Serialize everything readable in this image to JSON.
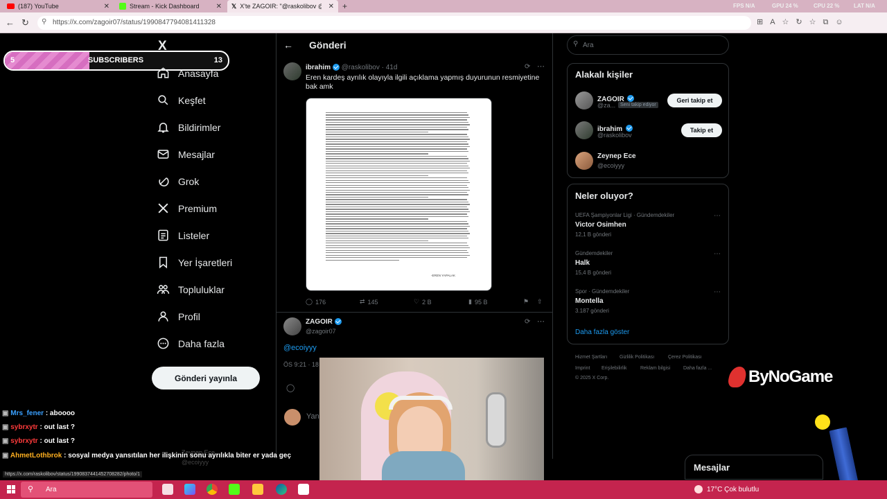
{
  "browser": {
    "tabs": [
      {
        "label": "(187) YouTube",
        "icon": "youtube-icon"
      },
      {
        "label": "Stream - Kick Dashboard",
        "icon": "kick-icon"
      },
      {
        "label": "X'te ZAGOIR: \"@raskolibov @eco",
        "icon": "x-icon"
      }
    ],
    "url": "https://x.com/zagoir07/status/1990847794081411328",
    "stats": {
      "fps": "FPS N/A",
      "gpu": "GPU 24 %",
      "cpu": "CPU 22 %",
      "lat": "LAT N/A"
    }
  },
  "subscribers": {
    "current": "5",
    "label": "SUBSCRIBERS",
    "goal": "13",
    "progress": 0.38
  },
  "nav": {
    "logo": "X",
    "items": [
      {
        "label": "Anasayfa",
        "icon": "home-icon"
      },
      {
        "label": "Keşfet",
        "icon": "search-icon"
      },
      {
        "label": "Bildirimler",
        "icon": "bell-icon"
      },
      {
        "label": "Mesajlar",
        "icon": "mail-icon"
      },
      {
        "label": "Grok",
        "icon": "grok-icon"
      },
      {
        "label": "Premium",
        "icon": "x-icon"
      },
      {
        "label": "Listeler",
        "icon": "list-icon"
      },
      {
        "label": "Yer İşaretleri",
        "icon": "bookmark-icon"
      },
      {
        "label": "Topluluklar",
        "icon": "communities-icon"
      },
      {
        "label": "Profil",
        "icon": "profile-icon"
      },
      {
        "label": "Daha fazla",
        "icon": "more-icon"
      }
    ],
    "post_button": "Gönderi yayınla"
  },
  "main": {
    "header": "Gönderi",
    "tweet1": {
      "name": "ibrahim",
      "handle": "@raskolibov",
      "time": "· 41d",
      "text": "Eren kardeş ayrılık olayıyla ilgili açıklama yapmış duyurunun resmiyetine bak amk",
      "image_signature": "-EREN YAPALAK",
      "replies": "176",
      "reposts": "145",
      "likes": "2 B",
      "views": "95 B"
    },
    "tweet2": {
      "name": "ZAGOIR",
      "handle": "@zagoir07",
      "text": "@ecoiyyy",
      "time_partial": "ÖS 9:21 · 18"
    },
    "reply_partial": "Yan",
    "bottom_partial_name": "Zeynep Ece",
    "bottom_partial_handle": "@ecoiyyy"
  },
  "right": {
    "search_placeholder": "Ara",
    "related": {
      "title": "Alakalı kişiler",
      "people": [
        {
          "name": "ZAGOIR",
          "handle": "@za...",
          "badge": "Seni takip ediyor",
          "button": "Geri takip et"
        },
        {
          "name": "ibrahim",
          "handle": "@raskolibov",
          "button": "Takip et"
        },
        {
          "name": "Zeynep Ece",
          "handle": "@ecoiyyy"
        }
      ]
    },
    "trends": {
      "title": "Neler oluyor?",
      "items": [
        {
          "category": "UEFA Şampiyonlar Ligi · Gündemdekiler",
          "name": "Victor Osimhen",
          "count": "12,1 B gönderi"
        },
        {
          "category": "Gündemdekiler",
          "name": "Halk",
          "count": "15,4 B gönderi"
        },
        {
          "category": "Spor · Gündemdekiler",
          "name": "Montella",
          "count": "3.187 gönderi"
        }
      ],
      "show_more": "Daha fazla göster"
    },
    "footer": [
      "Hizmet Şartları",
      "Gizlilik Politikası",
      "Çerez Politikası",
      "Imprint",
      "Erişilebilirlik",
      "Reklam bilgisi",
      "Daha fazla ...",
      "© 2025 X Corp."
    ],
    "messages": "Mesajlar"
  },
  "overlay": {
    "brand": "ByNoGame",
    "chat": [
      {
        "user": "Mrs_fener",
        "color": "#3aa0ff",
        "msg": " : aboooo"
      },
      {
        "user": "sybrxytr",
        "color": "#ff3b3b",
        "msg": " : out last ?"
      },
      {
        "user": "sybrxytr",
        "color": "#ff3b3b",
        "msg": " : out last ?"
      },
      {
        "user": "AhmetLothbrok",
        "color": "#ffb020",
        "msg": " : sosyal medya yansıtılan her ilişkinin sonu ayrılıkla biter er yada geç"
      }
    ],
    "status_url": "https://x.com/raskolibov/status/1990837441452708282/photo/1"
  },
  "taskbar": {
    "search": "Ara",
    "weather": "17°C  Çok bulutlu"
  }
}
